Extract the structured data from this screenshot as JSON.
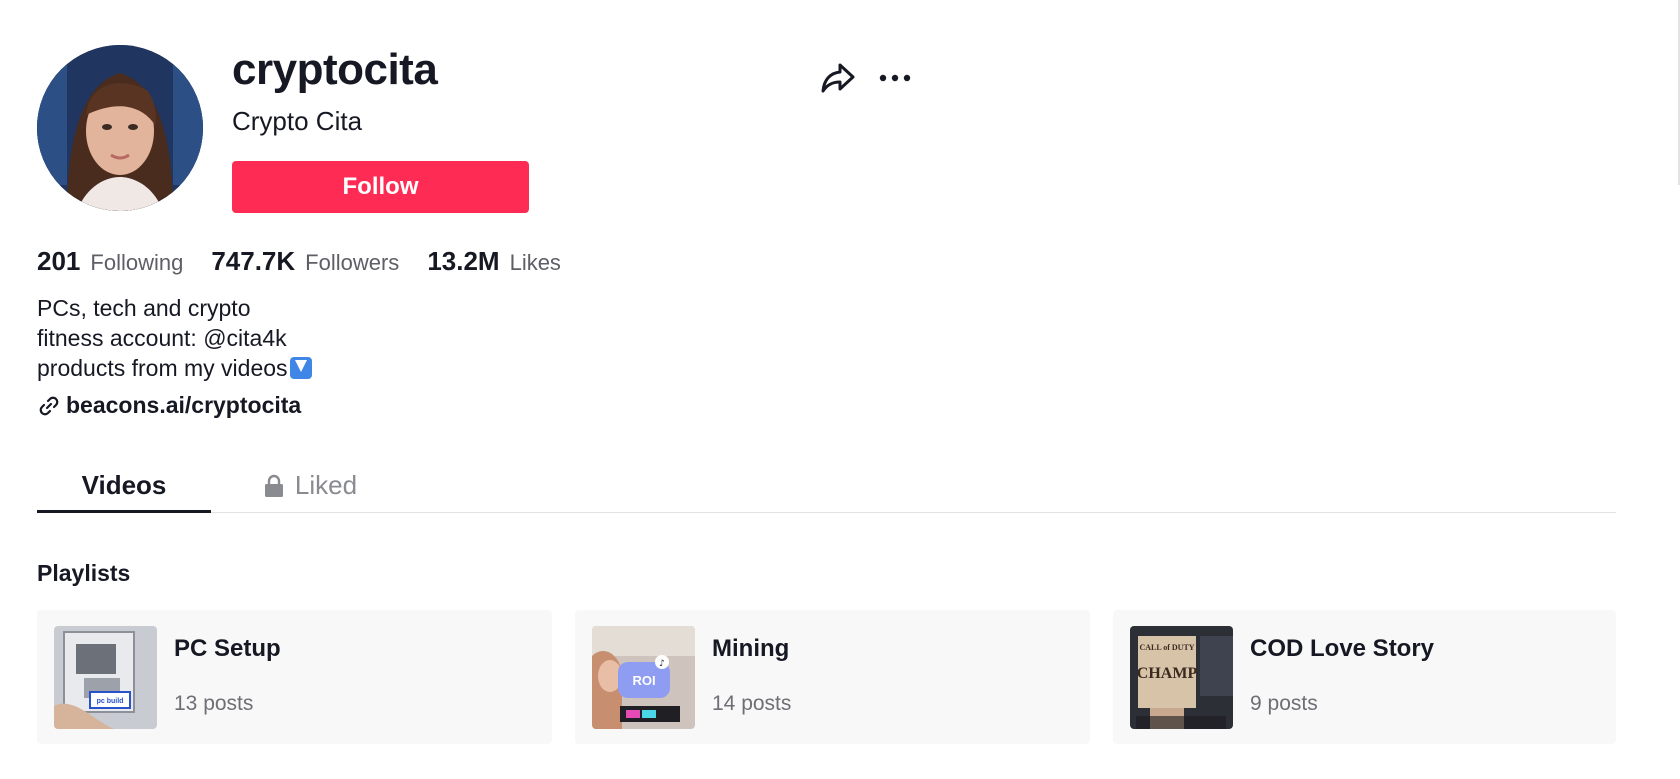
{
  "profile": {
    "username": "cryptocita",
    "nickname": "Crypto Cita",
    "follow_label": "Follow",
    "avatar_icon": "profile-photo",
    "share_icon": "share-arrow-icon",
    "more_icon": "ellipsis-icon"
  },
  "stats": [
    {
      "value": "201",
      "label": "Following"
    },
    {
      "value": "747.7K",
      "label": "Followers"
    },
    {
      "value": "13.2M",
      "label": "Likes"
    }
  ],
  "bio": {
    "line1": "PCs, tech and crypto",
    "line2": "fitness account: @cita4k",
    "line3": "products from my videos",
    "line3_emoji": "down-arrow-emoji"
  },
  "link": {
    "text": "beacons.ai/cryptocita",
    "icon": "link-icon"
  },
  "tabs": [
    {
      "label": "Videos",
      "active": true
    },
    {
      "label": "Liked",
      "active": false,
      "icon": "lock-icon"
    }
  ],
  "playlists": {
    "title": "Playlists",
    "items": [
      {
        "name": "PC Setup",
        "count": "13 posts",
        "thumb_text": "pc build"
      },
      {
        "name": "Mining",
        "count": "14 posts",
        "thumb_text": "ROI"
      },
      {
        "name": "COD Love Story",
        "count": "9 posts",
        "thumb_text": "CALL of DUTY CHAMP"
      }
    ]
  },
  "colors": {
    "accent": "#fe2c55",
    "text": "#161823",
    "muted": "#5e5f66",
    "card_bg": "#f8f8f8"
  }
}
